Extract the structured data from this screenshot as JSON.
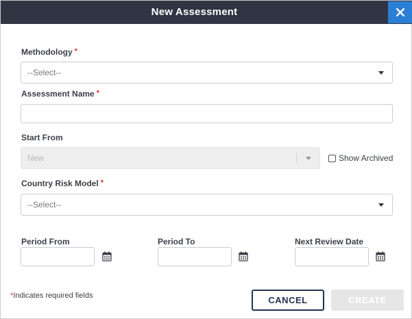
{
  "dialog": {
    "title": "New Assessment"
  },
  "form": {
    "methodology": {
      "label": "Methodology",
      "required_mark": "*",
      "value": "--Select--"
    },
    "assessment_name": {
      "label": "Assessment Name",
      "required_mark": "*",
      "value": ""
    },
    "start_from": {
      "label": "Start From",
      "value": "New",
      "disabled": true
    },
    "show_archived": {
      "label": "Show Archived",
      "checked": false
    },
    "country_risk_model": {
      "label": "Country Risk Model",
      "required_mark": "*",
      "value": "--Select--"
    },
    "period_from": {
      "label": "Period From",
      "value": ""
    },
    "period_to": {
      "label": "Period To",
      "value": ""
    },
    "next_review_date": {
      "label": "Next Review Date",
      "value": ""
    }
  },
  "footer": {
    "required_star": "*",
    "required_note": "Indicates required fields",
    "cancel_label": "CANCEL",
    "create_label": "CREATE"
  },
  "icons": {
    "close": "close-icon",
    "dropdown": "chevron-down-icon",
    "calendar": "calendar-icon"
  },
  "colors": {
    "title_bar": "#2f3542",
    "close_button": "#2a7fd4",
    "required": "#d9342b",
    "cancel_border": "#1f3350",
    "create_disabled": "#e6e6e6"
  }
}
